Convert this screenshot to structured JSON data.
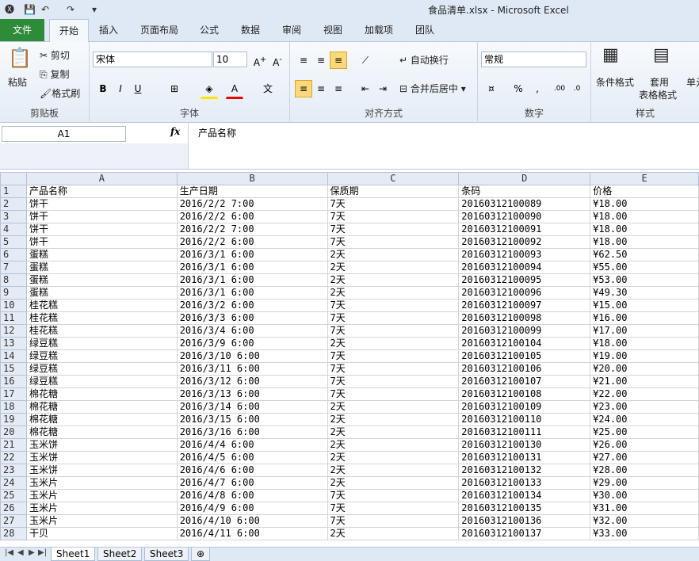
{
  "title": "食品清单.xlsx  -  Microsoft Excel",
  "tabs": [
    "文件",
    "开始",
    "插入",
    "页面布局",
    "公式",
    "数据",
    "审阅",
    "视图",
    "加载项",
    "团队"
  ],
  "ribbon": {
    "clipboard": {
      "paste": "粘贴",
      "cut": "剪切",
      "copy": "复制",
      "format_painter": "格式刷",
      "label": "剪贴板"
    },
    "font": {
      "name": "宋体",
      "size": "10",
      "label": "字体"
    },
    "alignment": {
      "wrap": "自动换行",
      "merge": "合并后居中",
      "label": "对齐方式"
    },
    "number": {
      "format": "常规",
      "label": "数字"
    },
    "styles": {
      "cond": "条件格式",
      "table": "套用",
      "table2": "表格格式",
      "cell": "单元",
      "label": "样式"
    }
  },
  "formula": {
    "namebox": "A1",
    "fx": "fx",
    "value": "产品名称"
  },
  "columns": [
    "A",
    "B",
    "C",
    "D",
    "E"
  ],
  "rows": [
    [
      "产品名称",
      "生产日期",
      "保质期",
      "条码",
      "价格"
    ],
    [
      "饼干",
      "2016/2/2 7:00",
      "7天",
      "20160312100089",
      "¥18.00"
    ],
    [
      "饼干",
      "2016/2/2 6:00",
      "7天",
      "20160312100090",
      "¥18.00"
    ],
    [
      "饼干",
      "2016/2/2 7:00",
      "7天",
      "20160312100091",
      "¥18.00"
    ],
    [
      "饼干",
      "2016/2/2 6:00",
      "7天",
      "20160312100092",
      "¥18.00"
    ],
    [
      "蛋糕",
      "2016/3/1 6:00",
      "2天",
      "20160312100093",
      "¥62.50"
    ],
    [
      "蛋糕",
      "2016/3/1 6:00",
      "2天",
      "20160312100094",
      "¥55.00"
    ],
    [
      "蛋糕",
      "2016/3/1 6:00",
      "2天",
      "20160312100095",
      "¥53.00"
    ],
    [
      "蛋糕",
      "2016/3/1 6:00",
      "2天",
      "20160312100096",
      "¥49.30"
    ],
    [
      "桂花糕",
      "2016/3/2 6:00",
      "7天",
      "20160312100097",
      "¥15.00"
    ],
    [
      "桂花糕",
      "2016/3/3 6:00",
      "7天",
      "20160312100098",
      "¥16.00"
    ],
    [
      "桂花糕",
      "2016/3/4 6:00",
      "7天",
      "20160312100099",
      "¥17.00"
    ],
    [
      "绿豆糕",
      "2016/3/9 6:00",
      "2天",
      "20160312100104",
      "¥18.00"
    ],
    [
      "绿豆糕",
      "2016/3/10 6:00",
      "7天",
      "20160312100105",
      "¥19.00"
    ],
    [
      "绿豆糕",
      "2016/3/11 6:00",
      "7天",
      "20160312100106",
      "¥20.00"
    ],
    [
      "绿豆糕",
      "2016/3/12 6:00",
      "7天",
      "20160312100107",
      "¥21.00"
    ],
    [
      "棉花糖",
      "2016/3/13 6:00",
      "7天",
      "20160312100108",
      "¥22.00"
    ],
    [
      "棉花糖",
      "2016/3/14 6:00",
      "2天",
      "20160312100109",
      "¥23.00"
    ],
    [
      "棉花糖",
      "2016/3/15 6:00",
      "2天",
      "20160312100110",
      "¥24.00"
    ],
    [
      "棉花糖",
      "2016/3/16 6:00",
      "2天",
      "20160312100111",
      "¥25.00"
    ],
    [
      "玉米饼",
      "2016/4/4 6:00",
      "2天",
      "20160312100130",
      "¥26.00"
    ],
    [
      "玉米饼",
      "2016/4/5 6:00",
      "2天",
      "20160312100131",
      "¥27.00"
    ],
    [
      "玉米饼",
      "2016/4/6 6:00",
      "2天",
      "20160312100132",
      "¥28.00"
    ],
    [
      "玉米片",
      "2016/4/7 6:00",
      "2天",
      "20160312100133",
      "¥29.00"
    ],
    [
      "玉米片",
      "2016/4/8 6:00",
      "7天",
      "20160312100134",
      "¥30.00"
    ],
    [
      "玉米片",
      "2016/4/9 6:00",
      "7天",
      "20160312100135",
      "¥31.00"
    ],
    [
      "玉米片",
      "2016/4/10 6:00",
      "7天",
      "20160312100136",
      "¥32.00"
    ],
    [
      "干贝",
      "2016/4/11 6:00",
      "2天",
      "20160312100137",
      "¥33.00"
    ]
  ],
  "sheets": [
    "Sheet1",
    "Sheet2",
    "Sheet3"
  ]
}
